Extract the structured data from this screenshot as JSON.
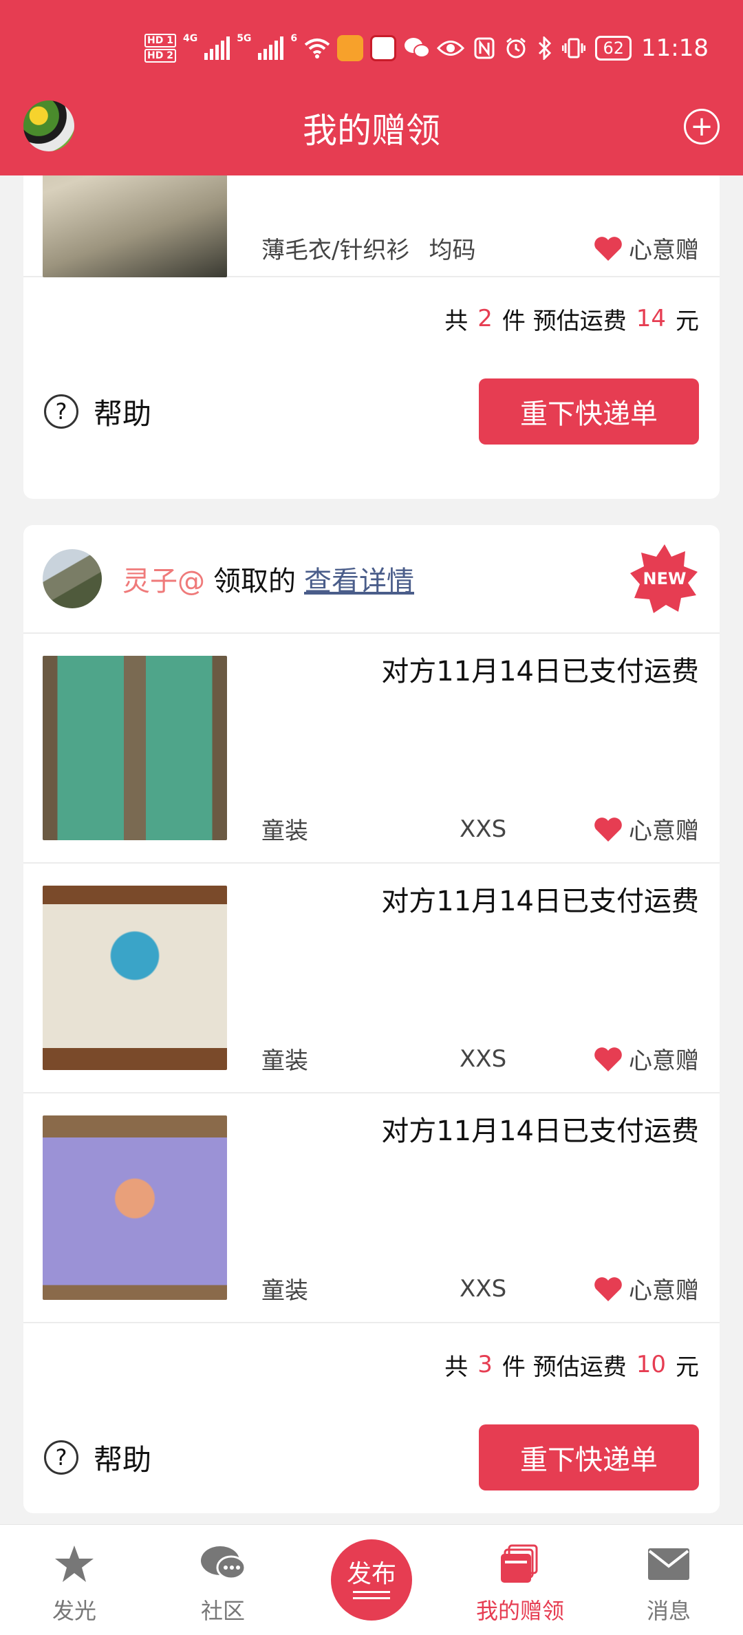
{
  "status_bar": {
    "hd1": "HD 1",
    "hd2": "HD 2",
    "net1": "4G",
    "net2": "5G",
    "wifi": "6",
    "battery": "62",
    "time": "11:18"
  },
  "header": {
    "title": "我的赠领"
  },
  "card1": {
    "item": {
      "category": "薄毛衣/针织衫",
      "size": "均码",
      "mode": "心意赠"
    },
    "summary": {
      "prefix": "共",
      "count": "2",
      "middle": "件 预估运费",
      "fee": "14",
      "suffix": "元"
    },
    "help_label": "帮助",
    "reorder_label": "重下快递单"
  },
  "card2": {
    "giver_name": "灵子@",
    "received_text": "领取的",
    "details_link": "查看详情",
    "badge": "NEW",
    "items": [
      {
        "paid_text": "对方11月14日已支付运费",
        "category": "童装",
        "size": "XXS",
        "mode": "心意赠"
      },
      {
        "paid_text": "对方11月14日已支付运费",
        "category": "童装",
        "size": "XXS",
        "mode": "心意赠"
      },
      {
        "paid_text": "对方11月14日已支付运费",
        "category": "童装",
        "size": "XXS",
        "mode": "心意赠"
      }
    ],
    "summary": {
      "prefix": "共",
      "count": "3",
      "middle": "件 预估运费",
      "fee": "10",
      "suffix": "元"
    },
    "help_label": "帮助",
    "reorder_label": "重下快递单"
  },
  "bottom_nav": {
    "shine": "发光",
    "community": "社区",
    "publish": "发布",
    "my_gifts": "我的赠领",
    "messages": "消息"
  },
  "colors": {
    "brand": "#e63d52",
    "link": "#4a5d8a",
    "giver_name": "#ef7a7a"
  }
}
